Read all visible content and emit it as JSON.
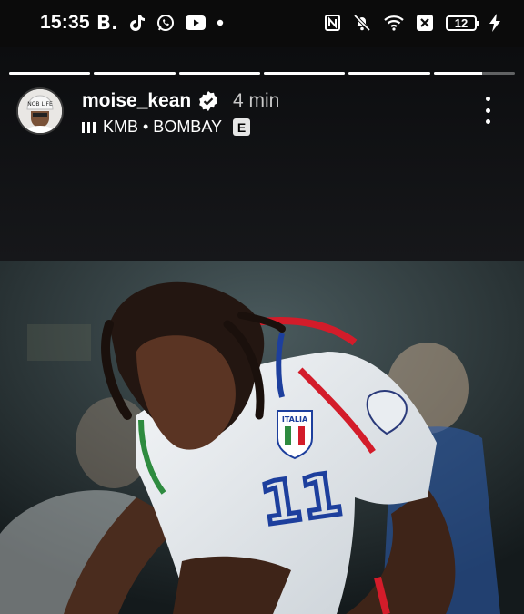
{
  "status_bar": {
    "time": "15:35",
    "left_icons": [
      "b-app-icon",
      "tiktok-icon",
      "whatsapp-icon",
      "youtube-icon",
      "notification-dot-icon"
    ],
    "b_label": "B.",
    "right_icons": [
      "nfc-icon",
      "mute-icon",
      "wifi-icon",
      "close-box-icon",
      "battery-icon",
      "charging-icon"
    ],
    "battery_level": "12"
  },
  "story": {
    "progress_segments": [
      1,
      1,
      1,
      1,
      1,
      0.6
    ],
    "username": "moise_kean",
    "time_ago": "4 min",
    "music": "KMB • BOMBAY",
    "explicit_badge": "E",
    "verified_icon": "verified-badge-icon",
    "more_icon": "more-vertical-icon",
    "jersey_number": "11",
    "badge_text": "ITALIA"
  }
}
